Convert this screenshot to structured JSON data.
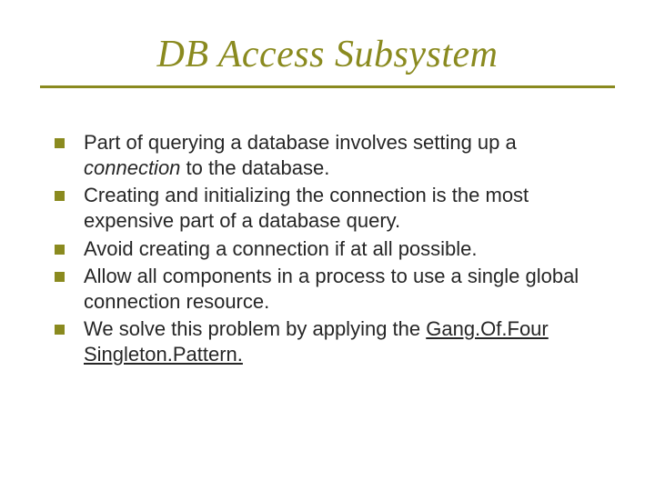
{
  "title": "DB Access Subsystem",
  "bullets_a": [
    {
      "pre": "Part of querying a database involves setting up a ",
      "em": "connection",
      "post": " to the database."
    },
    {
      "text": "Creating and initializing the connection is the most expensive part of a database query."
    },
    {
      "text": "Avoid creating a connection if at all possible."
    },
    {
      "text": "Allow all components in a process to use a single global connection resource."
    }
  ],
  "bullets_b": [
    {
      "pre": " We solve this problem by applying the ",
      "u1": "Gang.Of.Four",
      "mid": " ",
      "u2": "Singleton.Pattern.",
      "post": ""
    }
  ]
}
